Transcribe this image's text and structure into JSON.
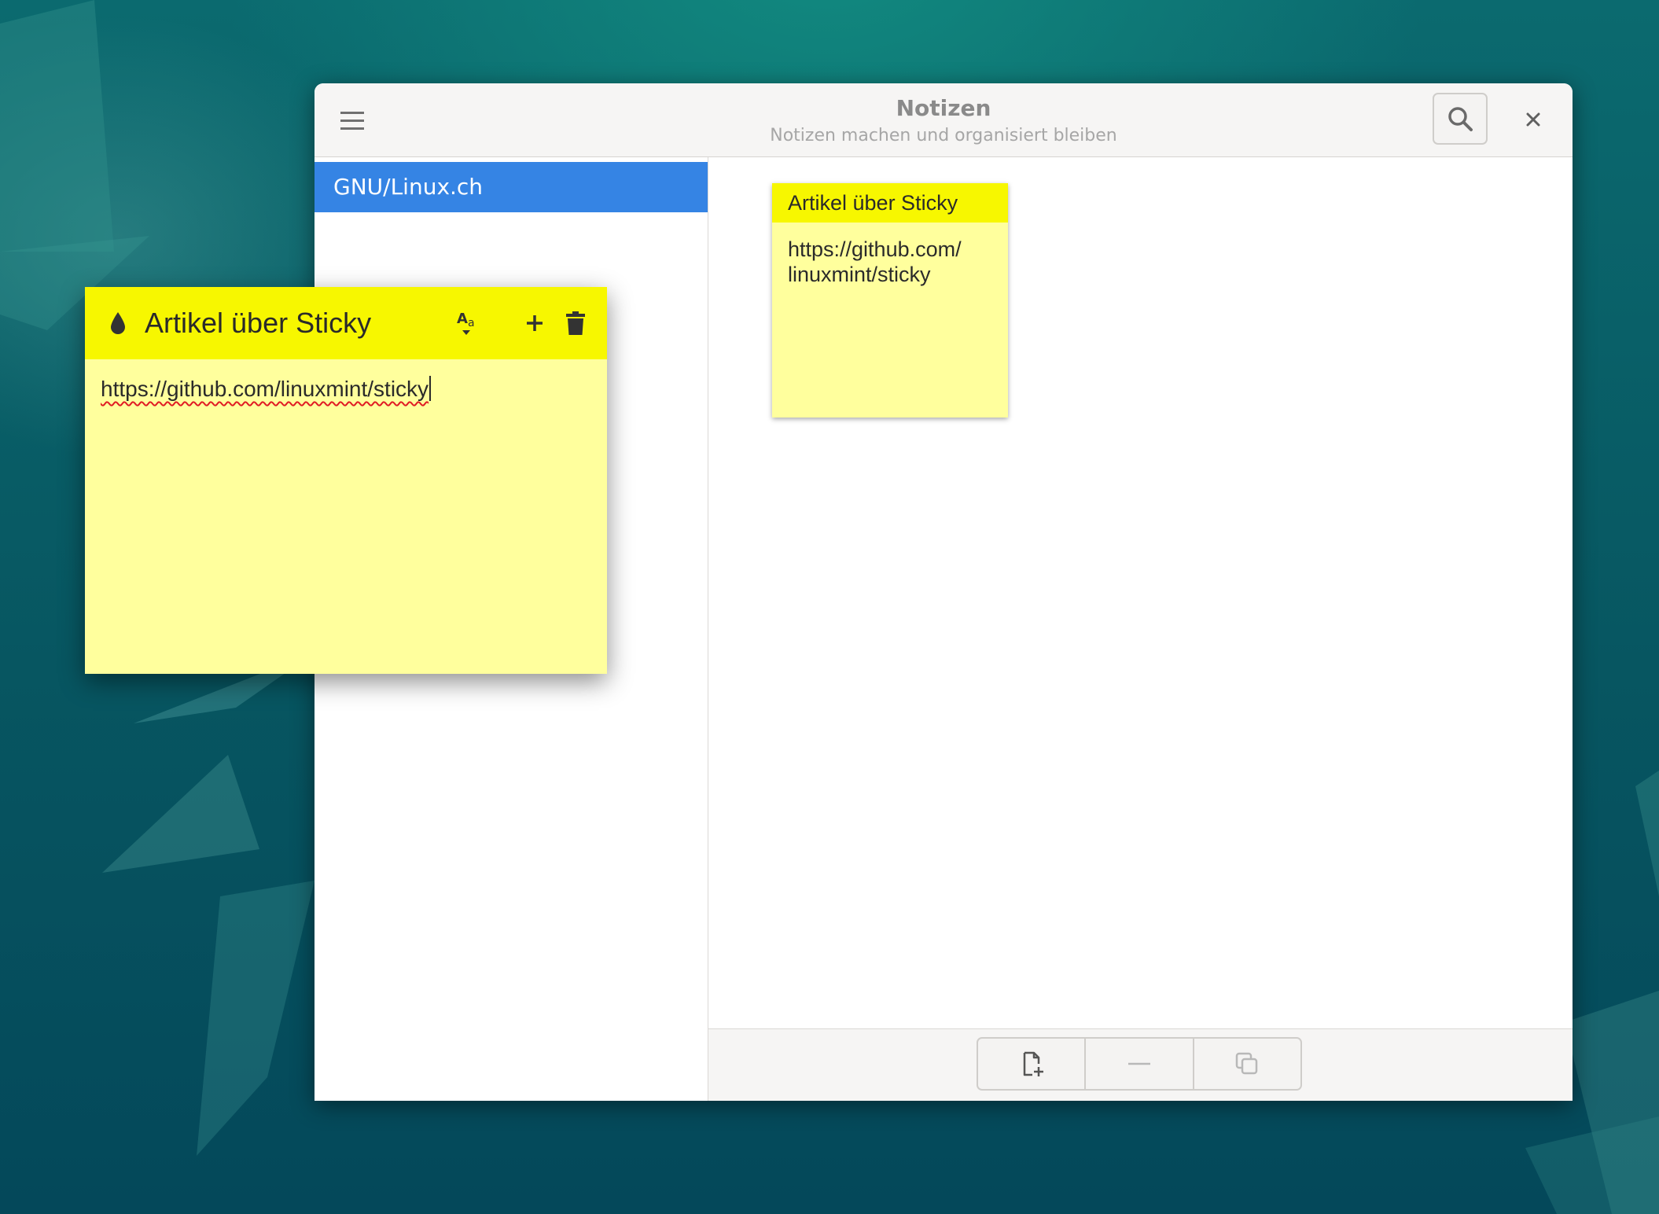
{
  "window": {
    "title": "Notizen",
    "subtitle": "Notizen machen und organisiert bleiben"
  },
  "sidebar": {
    "groups": [
      {
        "label": "GNU/Linux.ch",
        "selected": true
      }
    ]
  },
  "notes": [
    {
      "title": "Artikel über Sticky",
      "body": "https://github.com/\nlinuxmint/sticky"
    }
  ],
  "sticky_window": {
    "title": "Artikel über Sticky",
    "text": "https://github.com/linuxmint/sticky"
  },
  "icons": {
    "menu": "hamburger-menu-icon",
    "search": "search-icon",
    "close": "close-icon",
    "color": "drop-icon",
    "format": "text-format-icon",
    "add": "plus-icon",
    "delete": "trash-icon",
    "new_note": "new-note-icon",
    "remove_note": "minus-icon",
    "duplicate_note": "duplicate-icon"
  },
  "colors": {
    "accent": "#3584e4",
    "note_header": "#f7f700",
    "note_body": "#ffff9d",
    "desktop": "#075661"
  }
}
